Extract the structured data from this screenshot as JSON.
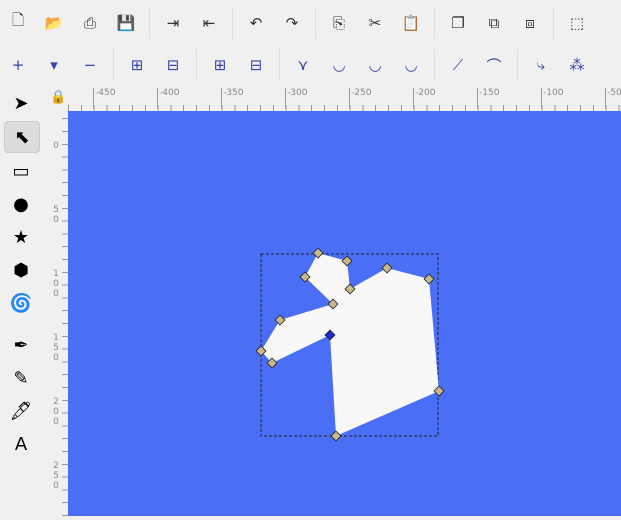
{
  "toolbar_commands": [
    {
      "name": "new-document",
      "glyph": "🗋"
    },
    {
      "name": "open",
      "glyph": "📂"
    },
    {
      "name": "print",
      "glyph": "⎙"
    },
    {
      "name": "save",
      "glyph": "💾"
    },
    {
      "name": "import",
      "glyph": "⇥"
    },
    {
      "name": "export",
      "glyph": "⇤"
    },
    {
      "name": "undo",
      "glyph": "↶"
    },
    {
      "name": "redo",
      "glyph": "↷"
    },
    {
      "name": "copy",
      "glyph": "⎘"
    },
    {
      "name": "cut",
      "glyph": "✂"
    },
    {
      "name": "paste",
      "glyph": "📋"
    },
    {
      "name": "duplicate",
      "glyph": "❐"
    },
    {
      "name": "clone",
      "glyph": "⧉"
    },
    {
      "name": "unlink-clone",
      "glyph": "⧈"
    },
    {
      "name": "zoom-selection",
      "glyph": "⬚"
    }
  ],
  "toolbar_nodes": [
    {
      "name": "insert-node",
      "glyph": "+"
    },
    {
      "name": "insert-dropdown",
      "glyph": "▾"
    },
    {
      "name": "delete-node",
      "glyph": "−"
    },
    {
      "name": "join-nodes",
      "glyph": "⊞"
    },
    {
      "name": "break-path",
      "glyph": "⊟"
    },
    {
      "name": "join-segment",
      "glyph": "⊞"
    },
    {
      "name": "delete-segment",
      "glyph": "⊟"
    },
    {
      "name": "cusp-node",
      "glyph": "⋎"
    },
    {
      "name": "smooth-node",
      "glyph": "◡"
    },
    {
      "name": "symmetric-node",
      "glyph": "◡"
    },
    {
      "name": "auto-smooth-node",
      "glyph": "◡"
    },
    {
      "name": "segment-line",
      "glyph": "⟋"
    },
    {
      "name": "segment-curve",
      "glyph": "⌒"
    },
    {
      "name": "object-to-path",
      "glyph": "⤷"
    },
    {
      "name": "stroke-to-path",
      "glyph": "⁂"
    }
  ],
  "ruler_h": [
    "-450",
    "-400",
    "-350",
    "-300",
    "-250",
    "-200",
    "-150",
    "-100",
    "-50"
  ],
  "ruler_v": [
    "0",
    "50",
    "100",
    "150",
    "200",
    "250"
  ],
  "tools": [
    {
      "name": "selector",
      "glyph": "➤"
    },
    {
      "name": "node",
      "glyph": "⬉"
    },
    {
      "name": "rect",
      "glyph": "▭"
    },
    {
      "name": "ellipse",
      "glyph": "●"
    },
    {
      "name": "star",
      "glyph": "★"
    },
    {
      "name": "3dbox",
      "glyph": "⬢"
    },
    {
      "name": "spiral",
      "glyph": "🌀"
    },
    {
      "name": "pen",
      "glyph": "✒"
    },
    {
      "name": "pencil",
      "glyph": "✎"
    },
    {
      "name": "calligraphy",
      "glyph": "🖋"
    },
    {
      "name": "text",
      "glyph": "A"
    }
  ],
  "colors": {
    "canvas": "#4a6ef5",
    "shape": "#f8f8f8"
  }
}
